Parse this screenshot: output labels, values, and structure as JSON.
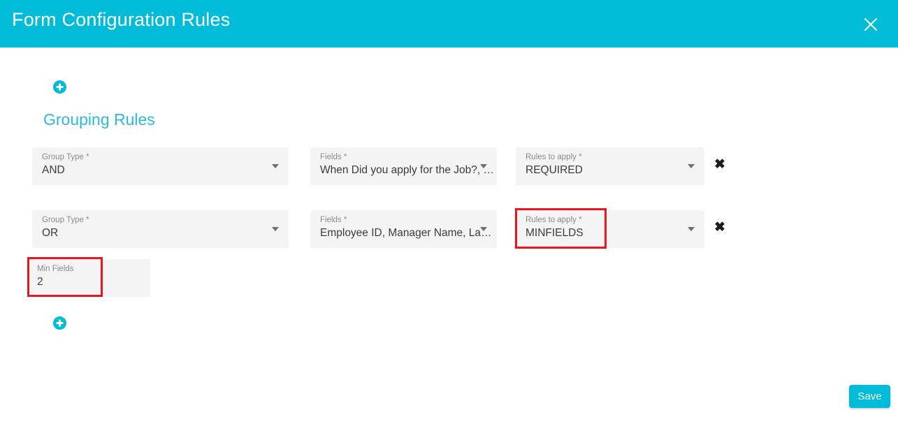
{
  "window": {
    "title": "Form Configuration Rules",
    "close_icon": "close-icon",
    "accent_color": "#00bcd9",
    "field_bg_color": "#f4f4f4",
    "annotation_color": "#e8161f"
  },
  "content": {
    "add_rule_icon_top": "add-circle-icon",
    "add_rule_icon_bottom": "add-circle-icon",
    "section_title": "Grouping Rules",
    "rows": [
      {
        "group_type": {
          "label": "Group Type *",
          "value": "AND",
          "dropdown_icon": "chevron-down-icon"
        },
        "fields": {
          "label": "Fields *",
          "value": "When Did you apply for the Job?, …",
          "dropdown_icon": "chevron-down-icon"
        },
        "rules_to_apply": {
          "label": "Rules to apply *",
          "value": "REQUIRED",
          "dropdown_icon": "chevron-down-icon"
        },
        "delete_icon": "close-icon"
      },
      {
        "group_type": {
          "label": "Group Type *",
          "value": "OR",
          "dropdown_icon": "chevron-down-icon"
        },
        "fields": {
          "label": "Fields *",
          "value": "Employee ID, Manager Name, La…",
          "dropdown_icon": "chevron-down-icon"
        },
        "rules_to_apply": {
          "label": "Rules to apply *",
          "value": "MINFIELDS",
          "dropdown_icon": "chevron-down-icon"
        },
        "delete_icon": "close-icon"
      }
    ],
    "min_fields": {
      "label": "Min Fields",
      "value": "2"
    }
  },
  "footer": {
    "save_label": "Save"
  }
}
